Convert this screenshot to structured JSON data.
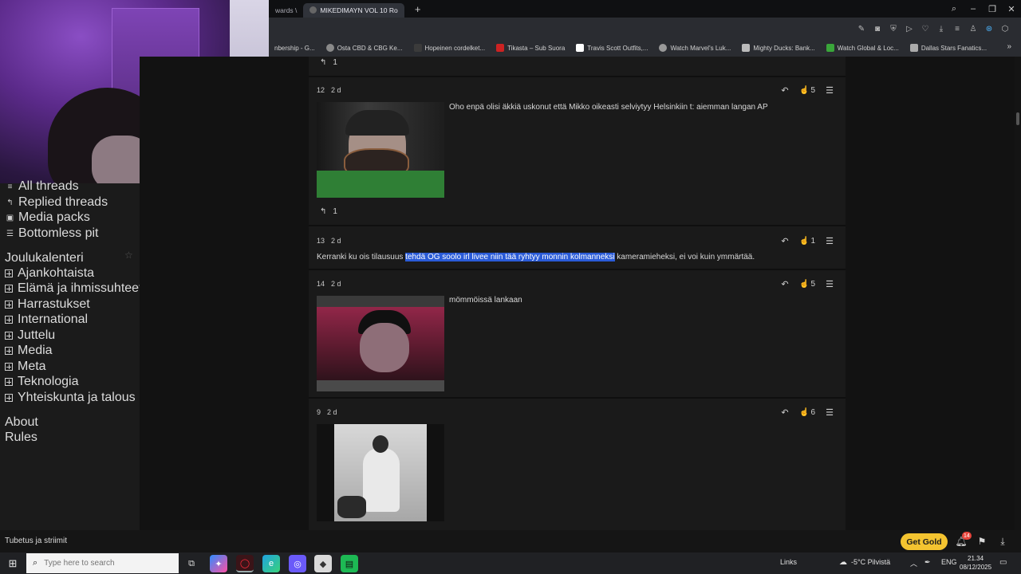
{
  "browser": {
    "tabs": [
      {
        "label": "wards \\",
        "active": false
      },
      {
        "label": "MIKEDIMAYN VOL 10 Ro",
        "active": true
      }
    ],
    "new_tab": "+",
    "window_controls": [
      "⌕",
      "–",
      "❐",
      "✕"
    ],
    "toolbar_icons": [
      "edit-icon",
      "camera-icon",
      "shield-icon",
      "play-icon",
      "heart-icon",
      "download-icon",
      "menu-icon",
      "user-icon",
      "extension-icon",
      "wallet-icon"
    ],
    "bookmarks": [
      {
        "label": "nbership - G...",
        "color": "#555555"
      },
      {
        "label": "Osta CBD & CBG Ke...",
        "color": "#8a8a8a"
      },
      {
        "label": "Hopeinen cordelket...",
        "color": "#3b3b3b"
      },
      {
        "label": "Tikasta – Sub Suora",
        "color": "#cc2222"
      },
      {
        "label": "Travis Scott Outfits,...",
        "color": "#ffffff"
      },
      {
        "label": "Watch Marvel's Luk...",
        "color": "#999999"
      },
      {
        "label": "Mighty Ducks: Bank...",
        "color": "#bbbbbb"
      },
      {
        "label": "Watch Global & Loc...",
        "color": "#3aa63a"
      },
      {
        "label": "Dallas Stars Fanatics...",
        "color": "#aaaaaa"
      }
    ],
    "bookmarks_more": "»"
  },
  "sidebar": {
    "items": [
      {
        "label": "All threads",
        "icon": "thread-icon",
        "glyph": "≡"
      },
      {
        "label": "Replied threads",
        "icon": "reply-icon",
        "glyph": "↰"
      },
      {
        "label": "Media packs",
        "icon": "media-icon",
        "glyph": "▣"
      },
      {
        "label": "Bottomless pit",
        "icon": "pit-icon",
        "glyph": "☰"
      }
    ],
    "calendar": "Joulukalenteri",
    "star": "☆",
    "categories": [
      "Ajankohtaista",
      "Elämä ja ihmissuhteet",
      "Harrastukset",
      "International",
      "Juttelu",
      "Media",
      "Meta",
      "Teknologia",
      "Yhteiskunta ja talous"
    ],
    "about": "About",
    "rules": "Rules"
  },
  "posts": {
    "top_reply_count": "1",
    "p12": {
      "num": "12",
      "age": "2 d",
      "likes": "5",
      "text": "Oho enpä olisi äkkiä uskonut että Mikko oikeasti selviytyy Helsinkiin t: aiemman langan AP",
      "replies": "1"
    },
    "p13": {
      "num": "13",
      "age": "2 d",
      "likes": "1",
      "text_before": "Kerranki ku ois tilausuus ",
      "text_selected": "tehdä  OG soolo irl livee niin tää ryhtyy monnin kolmanneksi",
      "text_after": " kameramieheksi, ei voi kuin ymmärtää."
    },
    "p14": {
      "num": "14",
      "age": "2 d",
      "likes": "5",
      "text": "mömmöissä lankaan"
    },
    "p9": {
      "num": "9",
      "age": "2 d",
      "likes": "6"
    }
  },
  "status": {
    "left_text": "Tubetus ja striimit",
    "get_gold": "Get Gold",
    "notifications": "14"
  },
  "taskbar": {
    "search_placeholder": "Type here to search",
    "links": "Links",
    "weather": "-5°C Pilvistä",
    "lang": "ENG",
    "time": "21.34",
    "date": "08/12/2025"
  },
  "colors": {
    "selection": "#2a5bd7",
    "gold": "#f4c430",
    "badge": "#e8453c"
  }
}
